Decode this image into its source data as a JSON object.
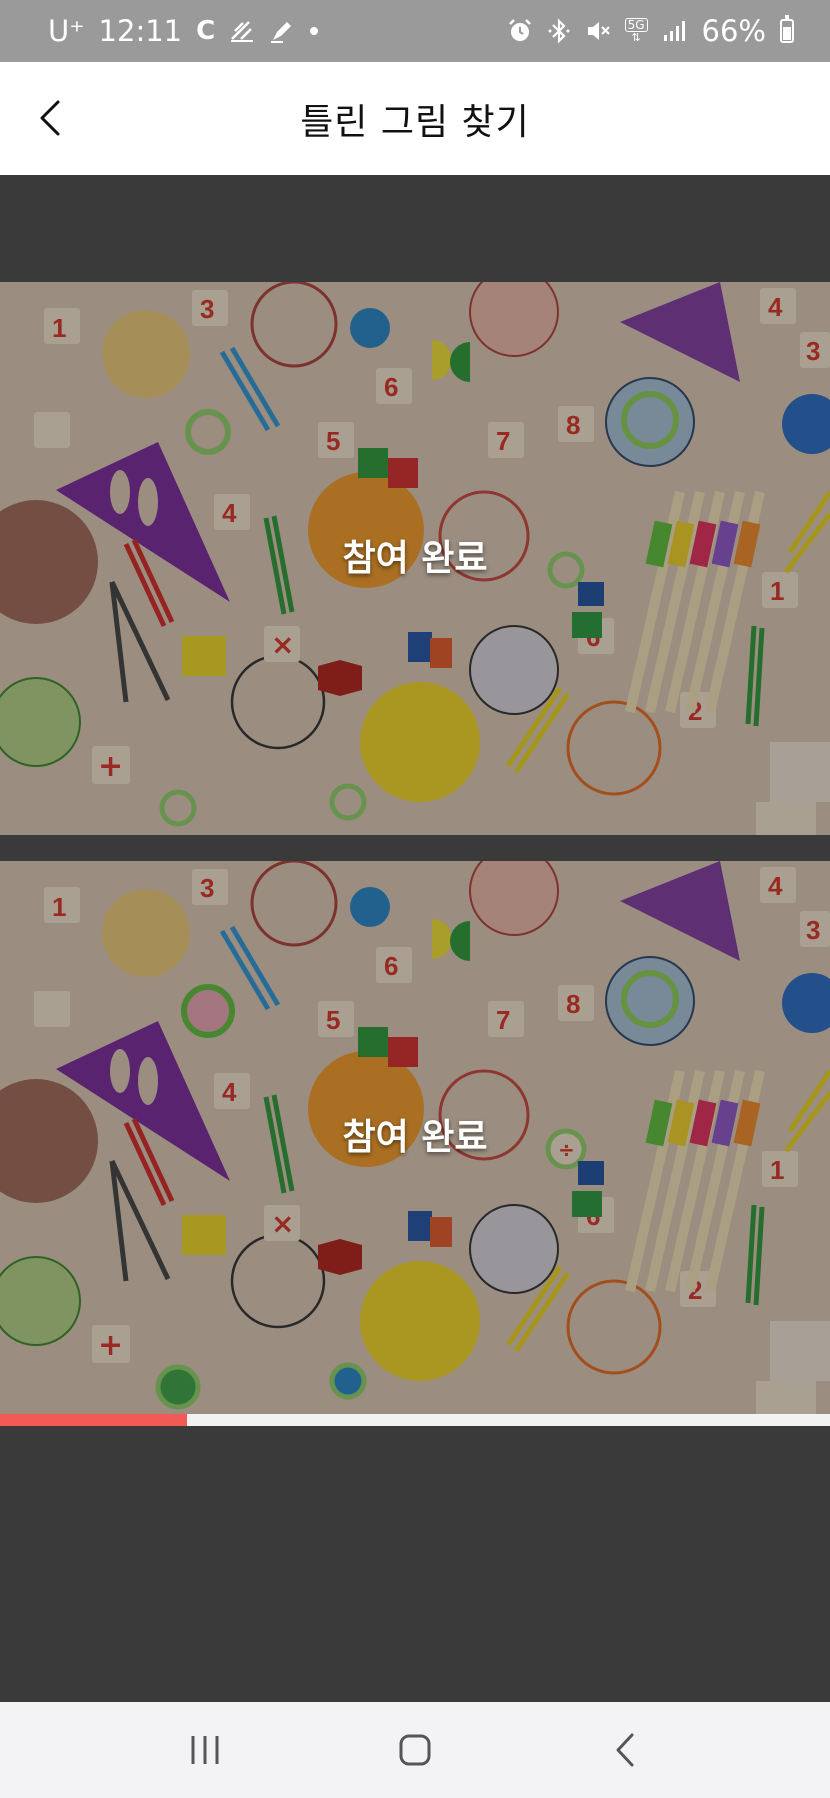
{
  "status_bar": {
    "carrier": "U⁺",
    "time": "12:11",
    "left_icons": [
      "c-app-icon",
      "sync-icon",
      "pen-icon",
      "dot-icon"
    ],
    "right_icons": [
      "alarm-icon",
      "bluetooth-icon",
      "mute-icon",
      "5g-icon",
      "signal-icon"
    ],
    "network": "5G",
    "battery_percent": "66%",
    "battery_level": 0.66
  },
  "header": {
    "title": "틀린 그림 찾기",
    "back_icon": "chevron-left-icon"
  },
  "game": {
    "top_panel_status": "참여 완료",
    "bottom_panel_status": "참여 완료",
    "progress": 0.225,
    "progress_color": "#f25a55"
  },
  "nav_bar": {
    "recents_icon": "recents-icon",
    "home_icon": "home-icon",
    "back_icon": "back-icon"
  },
  "colors": {
    "status_bar_bg": "#9a9a9a",
    "dim_bg": "#3a3a3a",
    "header_bg": "#ffffff"
  }
}
